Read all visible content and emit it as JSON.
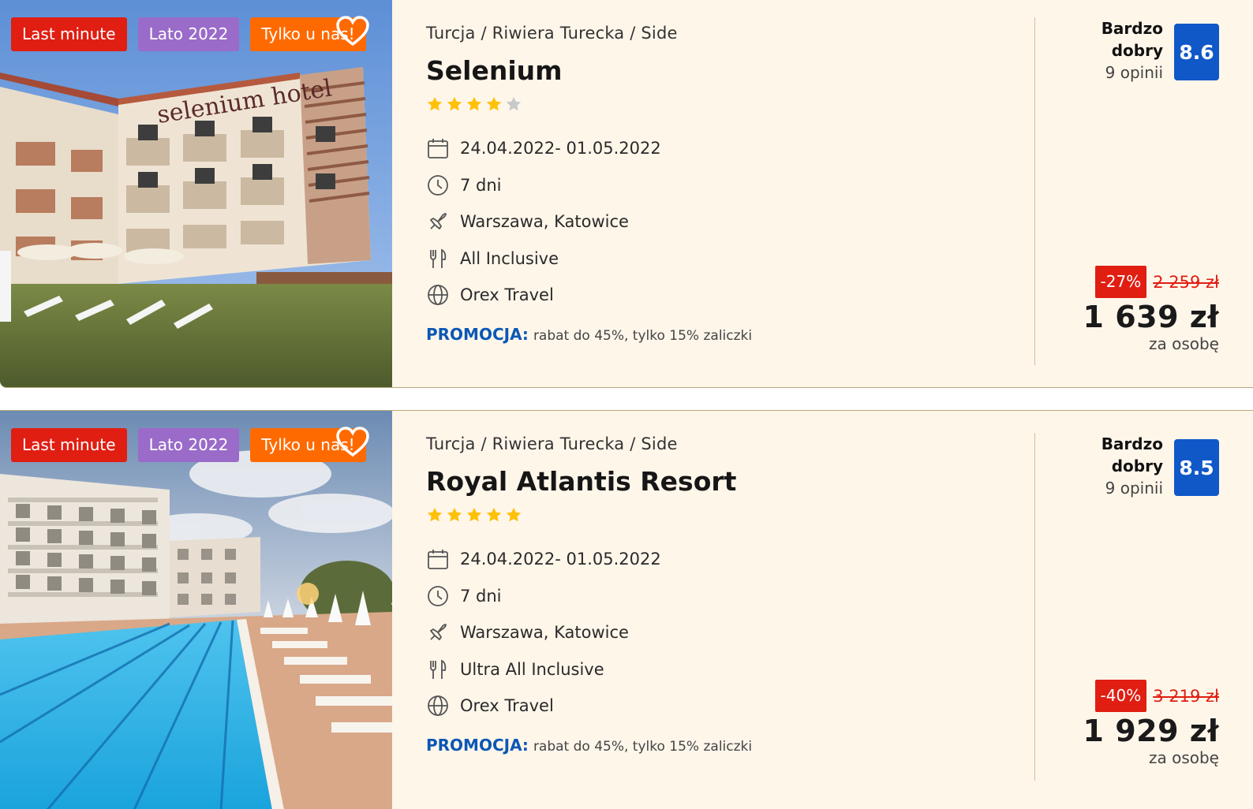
{
  "hotels": [
    {
      "tags": [
        "Last minute",
        "Lato 2022",
        "Tylko u nas!"
      ],
      "breadcrumb": "Turcja / Riwiera Turecka / Side",
      "name": "Selenium",
      "photo_sign": "selenium hotel",
      "stars": 4,
      "max_stars": 5,
      "dates": "24.04.2022- 01.05.2022",
      "duration": "7 dni",
      "departure": "Warszawa, Katowice",
      "board": "All Inclusive",
      "operator": "Orex Travel",
      "promo_label": "PROMOCJA:",
      "promo_text": "rabat do 45%, tylko 15% zaliczki",
      "rating_label": "Bardzo dobry",
      "rating_count": "9 opinii",
      "score": "8.6",
      "discount": "-27%",
      "old_price": "2 259 zł",
      "price": "1 639 zł",
      "per": "za osobę"
    },
    {
      "tags": [
        "Last minute",
        "Lato 2022",
        "Tylko u nas!"
      ],
      "breadcrumb": "Turcja / Riwiera Turecka / Side",
      "name": "Royal Atlantis Resort",
      "stars": 5,
      "max_stars": 5,
      "dates": "24.04.2022- 01.05.2022",
      "duration": "7 dni",
      "departure": "Warszawa, Katowice",
      "board": "Ultra All Inclusive",
      "operator": "Orex Travel",
      "promo_label": "PROMOCJA:",
      "promo_text": "rabat do 45%, tylko 15% zaliczki",
      "rating_label": "Bardzo dobry",
      "rating_count": "9 opinii",
      "score": "8.5",
      "discount": "-40%",
      "old_price": "3 219 zł",
      "price": "1 929 zł",
      "per": "za osobę"
    }
  ],
  "icons": {
    "dates": "calendar-icon",
    "duration": "clock-icon",
    "departure": "plane-icon",
    "board": "cutlery-icon",
    "operator": "globe-icon",
    "favorite": "heart-icon",
    "star": "star-icon"
  },
  "colors": {
    "card_bg": "#fff6ea",
    "tag_red": "#e01e12",
    "tag_purple": "#9a6bc9",
    "tag_orange": "#ff6a00",
    "score_bg": "#1058c8",
    "promo": "#0b57b5",
    "star_on": "#ffc107",
    "star_off": "#c8c8c8"
  }
}
